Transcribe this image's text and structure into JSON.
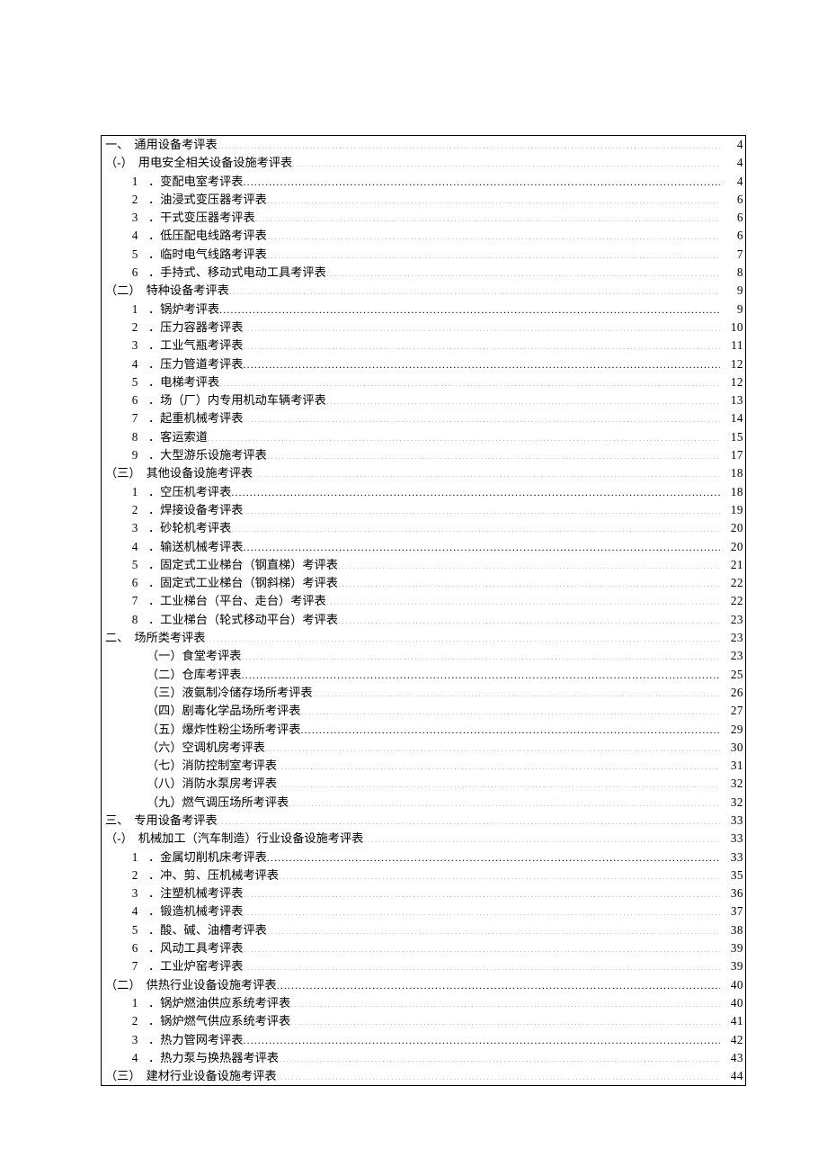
{
  "toc": [
    {
      "indent": 0,
      "num": "一、",
      "numbered": false,
      "text": "通用设备考评表",
      "page": "4"
    },
    {
      "indent": 0,
      "num": "（-）",
      "numbered": false,
      "text": "用电安全相关设备设施考评表",
      "page": "4"
    },
    {
      "indent": 1,
      "num": "1",
      "numbered": true,
      "text": "．变配电室考评表",
      "page": "4"
    },
    {
      "indent": 1,
      "num": "2",
      "numbered": true,
      "text": "．油浸式变压器考评表",
      "page": "6"
    },
    {
      "indent": 1,
      "num": "3",
      "numbered": true,
      "text": "．干式变压器考评表",
      "page": "6"
    },
    {
      "indent": 1,
      "num": "4",
      "numbered": true,
      "text": "．低压配电线路考评表",
      "page": "6"
    },
    {
      "indent": 1,
      "num": "5",
      "numbered": true,
      "text": "．临时电气线路考评表",
      "page": "7"
    },
    {
      "indent": 1,
      "num": "6",
      "numbered": true,
      "text": "．手持式、移动式电动工具考评表",
      "page": "8"
    },
    {
      "indent": 0,
      "num": "（二）",
      "numbered": false,
      "text": "特种设备考评表",
      "page": "9"
    },
    {
      "indent": 1,
      "num": "1",
      "numbered": true,
      "text": "．锅炉考评表",
      "page": "9"
    },
    {
      "indent": 1,
      "num": "2",
      "numbered": true,
      "text": "．压力容器考评表",
      "page": "10"
    },
    {
      "indent": 1,
      "num": "3",
      "numbered": true,
      "text": "．工业气瓶考评表",
      "page": "11"
    },
    {
      "indent": 1,
      "num": "4",
      "numbered": true,
      "text": "．压力管道考评表",
      "page": "12"
    },
    {
      "indent": 1,
      "num": "5",
      "numbered": true,
      "text": "．电梯考评表",
      "page": "12"
    },
    {
      "indent": 1,
      "num": "6",
      "numbered": true,
      "text": "．场（厂）内专用机动车辆考评表",
      "page": "13"
    },
    {
      "indent": 1,
      "num": "7",
      "numbered": true,
      "text": "．起重机械考评表",
      "page": "14"
    },
    {
      "indent": 1,
      "num": "8",
      "numbered": true,
      "text": "．客运索道",
      "page": "15"
    },
    {
      "indent": 1,
      "num": "9",
      "numbered": true,
      "text": "．大型游乐设施考评表",
      "page": "17"
    },
    {
      "indent": 0,
      "num": "（三）",
      "numbered": false,
      "text": "其他设备设施考评表",
      "page": "18"
    },
    {
      "indent": 1,
      "num": "1",
      "numbered": true,
      "text": "．空压机考评表",
      "page": "18"
    },
    {
      "indent": 1,
      "num": "2",
      "numbered": true,
      "text": "．焊接设备考评表",
      "page": "19"
    },
    {
      "indent": 1,
      "num": "3",
      "numbered": true,
      "text": "．砂轮机考评表",
      "page": "20"
    },
    {
      "indent": 1,
      "num": "4",
      "numbered": true,
      "text": "．输送机械考评表",
      "page": "20"
    },
    {
      "indent": 1,
      "num": "5",
      "numbered": true,
      "text": "．固定式工业梯台（钢直梯）考评表",
      "page": "21"
    },
    {
      "indent": 1,
      "num": "6",
      "numbered": true,
      "text": "．固定式工业梯台（钢斜梯）考评表",
      "page": "22"
    },
    {
      "indent": 1,
      "num": "7",
      "numbered": true,
      "text": "．工业梯台（平台、走台）考评表",
      "page": "22"
    },
    {
      "indent": 1,
      "num": "8",
      "numbered": true,
      "text": "．工业梯台（轮式移动平台）考评表",
      "page": "23"
    },
    {
      "indent": 0,
      "num": "二、",
      "numbered": false,
      "text": "场所类考评表",
      "page": "23"
    },
    {
      "indent": 2,
      "num": "",
      "numbered": false,
      "text": "（一）食堂考评表",
      "page": "23"
    },
    {
      "indent": 2,
      "num": "",
      "numbered": false,
      "text": "（二）仓库考评表",
      "page": "25"
    },
    {
      "indent": 2,
      "num": "",
      "numbered": false,
      "text": "（三）液氨制冷储存场所考评表",
      "page": "26"
    },
    {
      "indent": 2,
      "num": "",
      "numbered": false,
      "text": "（四）剧毒化学品场所考评表",
      "page": "27"
    },
    {
      "indent": 2,
      "num": "",
      "numbered": false,
      "text": "（五）爆炸性粉尘场所考评表",
      "page": "29"
    },
    {
      "indent": 2,
      "num": "",
      "numbered": false,
      "text": "（六）空调机房考评表",
      "page": "30"
    },
    {
      "indent": 2,
      "num": "",
      "numbered": false,
      "text": "（七）消防控制室考评表",
      "page": "31"
    },
    {
      "indent": 2,
      "num": "",
      "numbered": false,
      "text": "（八）消防水泵房考评表",
      "page": "32"
    },
    {
      "indent": 2,
      "num": "",
      "numbered": false,
      "text": "（九）燃气调压场所考评表",
      "page": "32"
    },
    {
      "indent": 0,
      "num": "三、",
      "numbered": false,
      "text": "专用设备考评表",
      "page": "33"
    },
    {
      "indent": 0,
      "num": "（-）",
      "numbered": false,
      "text": "机械加工（汽车制造）行业设备设施考评表",
      "page": "33"
    },
    {
      "indent": 1,
      "num": "1",
      "numbered": true,
      "text": "．金属切削机床考评表",
      "page": "33"
    },
    {
      "indent": 1,
      "num": "2",
      "numbered": true,
      "text": "．冲、剪、压机械考评表",
      "page": "35"
    },
    {
      "indent": 1,
      "num": "3",
      "numbered": true,
      "text": "．注塑机械考评表",
      "page": "36"
    },
    {
      "indent": 1,
      "num": "4",
      "numbered": true,
      "text": "．锻造机械考评表",
      "page": "37"
    },
    {
      "indent": 1,
      "num": "5",
      "numbered": true,
      "text": "．酸、碱、油槽考评表",
      "page": "38"
    },
    {
      "indent": 1,
      "num": "6",
      "numbered": true,
      "text": "．风动工具考评表",
      "page": "39"
    },
    {
      "indent": 1,
      "num": "7",
      "numbered": true,
      "text": "．工业炉窑考评表",
      "page": "39"
    },
    {
      "indent": 0,
      "num": "（二）",
      "numbered": false,
      "text": "供热行业设备设施考评表",
      "page": "40"
    },
    {
      "indent": 1,
      "num": "1",
      "numbered": true,
      "text": "．锅炉燃油供应系统考评表",
      "page": "40"
    },
    {
      "indent": 1,
      "num": "2",
      "numbered": true,
      "text": "．锅炉燃气供应系统考评表",
      "page": "41"
    },
    {
      "indent": 1,
      "num": "3",
      "numbered": true,
      "text": "．热力管网考评表",
      "page": "42"
    },
    {
      "indent": 1,
      "num": "4",
      "numbered": true,
      "text": "．热力泵与换热器考评表",
      "page": "43"
    },
    {
      "indent": 0,
      "num": "（三）",
      "numbered": false,
      "text": "建材行业设备设施考评表",
      "page": "44"
    }
  ]
}
